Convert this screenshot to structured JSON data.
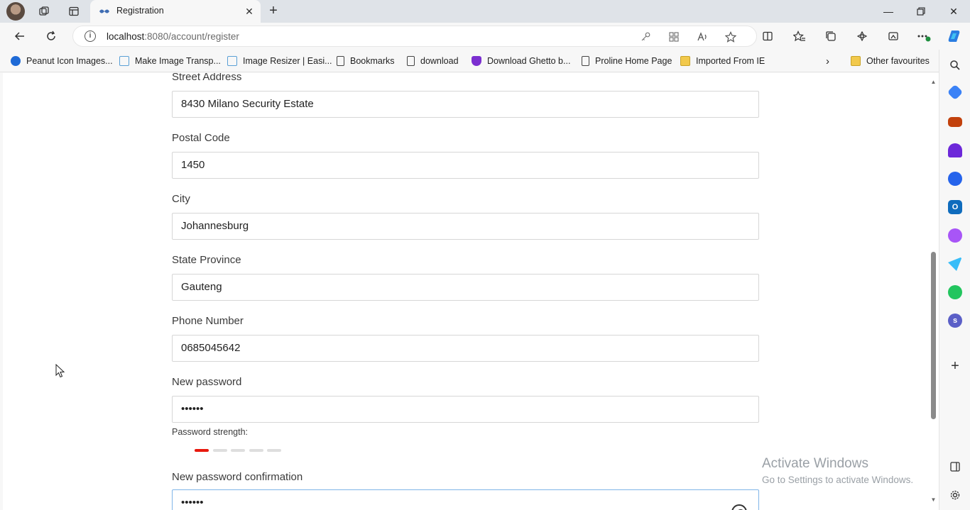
{
  "browser": {
    "tab": {
      "title": "Registration"
    },
    "address": {
      "host": "localhost",
      "path": ":8080/account/register"
    },
    "bookmarks": [
      {
        "label": "Peanut Icon Images...",
        "icon": "peanut-icon"
      },
      {
        "label": "Make Image Transp...",
        "icon": "image-icon"
      },
      {
        "label": "Image Resizer | Easi...",
        "icon": "image-icon"
      },
      {
        "label": "Bookmarks",
        "icon": "page-icon"
      },
      {
        "label": "download",
        "icon": "page-icon"
      },
      {
        "label": "Download Ghetto b...",
        "icon": "ghetto-icon"
      },
      {
        "label": "Proline Home Page",
        "icon": "page-icon"
      },
      {
        "label": "Imported From IE",
        "icon": "folder-icon"
      }
    ],
    "other_favourites": "Other favourites"
  },
  "form": {
    "street": {
      "label": "Street Address",
      "value": "8430 Milano Security Estate"
    },
    "postal": {
      "label": "Postal Code",
      "value": "1450"
    },
    "city": {
      "label": "City",
      "value": "Johannesburg"
    },
    "state": {
      "label": "State Province",
      "value": "Gauteng"
    },
    "phone": {
      "label": "Phone Number",
      "value": "0685045642"
    },
    "password": {
      "label": "New password",
      "value": "••••••"
    },
    "strength": {
      "label": "Password strength:",
      "level": 1,
      "max": 5,
      "active_color": "#e8190e",
      "inactive_color": "#dedede"
    },
    "confirm": {
      "label": "New password confirmation",
      "value": "••••••"
    }
  },
  "watermark": {
    "title": "Activate Windows",
    "subtitle": "Go to Settings to activate Windows."
  },
  "colors": {
    "accent": "#1a73e8",
    "strength_active": "#e8190e"
  }
}
